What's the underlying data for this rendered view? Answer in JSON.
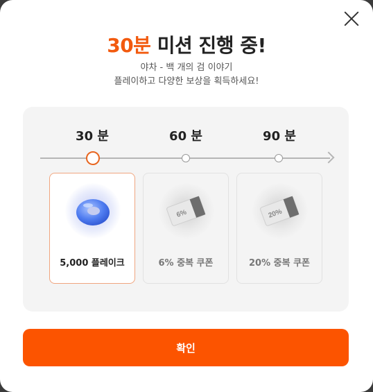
{
  "title": {
    "accent": "30분",
    "rest": " 미션 진행 중!"
  },
  "subtitle": {
    "line1": "야차 - 백 개의 검 이야기",
    "line2": "플레이하고 다양한 보상을 획득하세요!"
  },
  "steps": [
    {
      "label": "30 분",
      "reward": "5,000 플레이크",
      "status": "active",
      "icon": "donut-icon"
    },
    {
      "label": "60 분",
      "reward": "6% 중복 쿠폰",
      "status": "locked",
      "icon": "coupon-icon",
      "coupon_text": "6%"
    },
    {
      "label": "90 분",
      "reward": "20% 중복 쿠폰",
      "status": "locked",
      "icon": "coupon-icon",
      "coupon_text": "20%"
    }
  ],
  "confirm_label": "확인",
  "colors": {
    "accent": "#f25a0f",
    "button": "#fc5400"
  }
}
